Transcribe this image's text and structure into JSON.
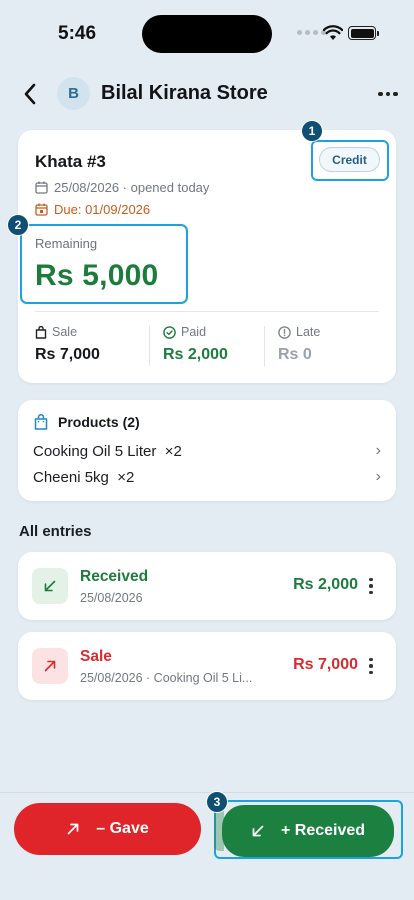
{
  "status_bar": {
    "time": "5:46"
  },
  "header": {
    "avatar_initial": "B",
    "title": "Bilal Kirana Store"
  },
  "khata": {
    "title": "Khata #3",
    "badge": "Credit",
    "opened": "25/08/2026 · opened today",
    "due": "Due: 01/09/2026",
    "remaining_label": "Remaining",
    "remaining_value": "Rs 5,000",
    "stats": [
      {
        "label": "Sale",
        "value": "Rs 7,000"
      },
      {
        "label": "Paid",
        "value": "Rs 2,000"
      },
      {
        "label": "Late",
        "value": "Rs 0"
      }
    ]
  },
  "products": {
    "heading": "Products (2)",
    "items": [
      {
        "name": "Cooking Oil 5 Liter  ×2"
      },
      {
        "name": "Cheeni 5kg  ×2"
      }
    ]
  },
  "entries_title": "All entries",
  "entries": [
    {
      "type": "Received",
      "sub": "25/08/2026",
      "amount": "Rs 2,000"
    },
    {
      "type": "Sale",
      "sub": "25/08/2026 · Cooking Oil 5 Li...",
      "amount": "Rs 7,000"
    }
  ],
  "actions": {
    "gave": "– Gave",
    "received": "+ Received"
  },
  "markers": [
    "1",
    "2",
    "3"
  ],
  "colors": {
    "green": "#1d7c3c",
    "red": "#e0252a",
    "highlight": "#1da1e0",
    "due_orange": "#c85d1e"
  },
  "icons": {
    "back": "chevron-left-icon",
    "more": "more-horizontal-icon",
    "calendar": "calendar-icon",
    "bag": "shopping-bag-icon",
    "check": "check-circle-icon",
    "alert": "alert-circle-icon",
    "arrow_in": "arrow-down-left-icon",
    "arrow_out": "arrow-up-right-icon"
  }
}
